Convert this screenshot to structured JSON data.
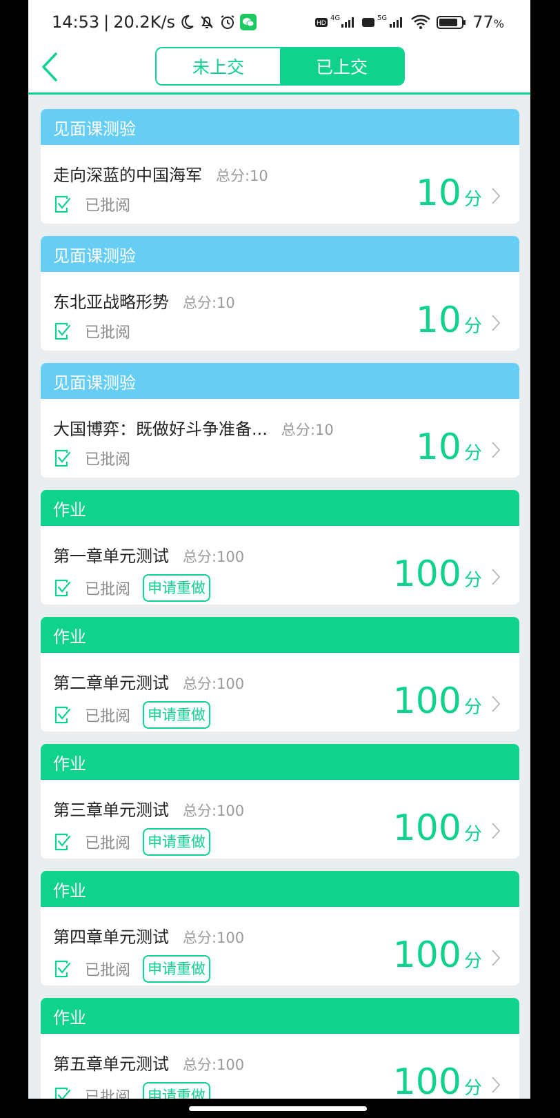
{
  "status_bar": {
    "time": "14:53",
    "speed": "20.2K/s",
    "battery": "77",
    "battery_unit": "%",
    "network_1": "4G",
    "network_2": "5G",
    "hd": "HD"
  },
  "tabs": [
    {
      "label": "未上交",
      "active": false
    },
    {
      "label": "已上交",
      "active": true
    }
  ],
  "colors": {
    "accent": "#0fd28c",
    "header_blue": "#66cdf5",
    "background": "#ebeef1"
  },
  "cards": [
    {
      "category": "见面课测验",
      "title": "走向深蓝的中国海军",
      "total": "总分:10",
      "status": "已批阅",
      "score": "10",
      "unit": "分",
      "redo": ""
    },
    {
      "category": "见面课测验",
      "title": "东北亚战略形势",
      "total": "总分:10",
      "status": "已批阅",
      "score": "10",
      "unit": "分",
      "redo": ""
    },
    {
      "category": "见面课测验",
      "title": "大国博弈：既做好斗争准备...",
      "total": "总分:10",
      "status": "已批阅",
      "score": "10",
      "unit": "分",
      "redo": ""
    },
    {
      "category": "作业",
      "title": "第一章单元测试",
      "total": "总分:100",
      "status": "已批阅",
      "score": "100",
      "unit": "分",
      "redo": "申请重做"
    },
    {
      "category": "作业",
      "title": "第二章单元测试",
      "total": "总分:100",
      "status": "已批阅",
      "score": "100",
      "unit": "分",
      "redo": "申请重做"
    },
    {
      "category": "作业",
      "title": "第三章单元测试",
      "total": "总分:100",
      "status": "已批阅",
      "score": "100",
      "unit": "分",
      "redo": "申请重做"
    },
    {
      "category": "作业",
      "title": "第四章单元测试",
      "total": "总分:100",
      "status": "已批阅",
      "score": "100",
      "unit": "分",
      "redo": "申请重做"
    },
    {
      "category": "作业",
      "title": "第五章单元测试",
      "total": "总分:100",
      "status": "已批阅",
      "score": "100",
      "unit": "分",
      "redo": "申请重做"
    }
  ]
}
